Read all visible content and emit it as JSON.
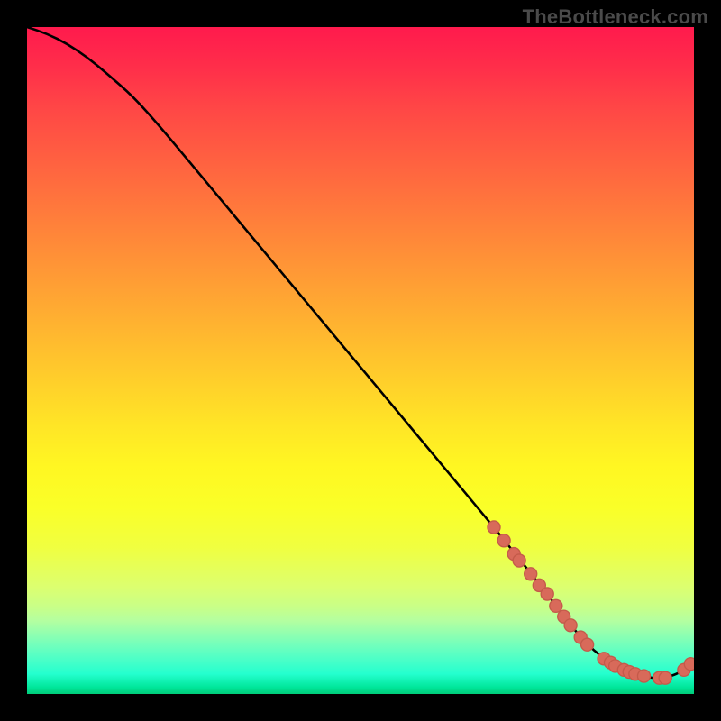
{
  "attribution": "TheBottleneck.com",
  "colors": {
    "curve": "#000000",
    "marker_fill": "#d86a5a",
    "marker_stroke": "#c45a4a"
  },
  "chart_data": {
    "type": "line",
    "title": "",
    "xlabel": "",
    "ylabel": "",
    "xlim": [
      0,
      100
    ],
    "ylim": [
      0,
      100
    ],
    "grid": false,
    "legend": false,
    "series": [
      {
        "name": "curve",
        "x": [
          0,
          3,
          6,
          9,
          12,
          16,
          20,
          25,
          30,
          35,
          40,
          45,
          50,
          55,
          60,
          65,
          70,
          74,
          78,
          81,
          83,
          85,
          87,
          89,
          91,
          93,
          95,
          97,
          98.5,
          100
        ],
        "y": [
          100,
          99,
          97.5,
          95.5,
          93,
          89.5,
          85,
          79,
          73,
          67,
          61,
          55,
          49,
          43,
          37,
          31,
          25,
          20,
          15,
          11,
          8.5,
          6.5,
          5,
          3.8,
          3,
          2.5,
          2.3,
          2.8,
          3.6,
          5
        ]
      }
    ],
    "markers": [
      {
        "x": 70,
        "y": 25
      },
      {
        "x": 71.5,
        "y": 23
      },
      {
        "x": 73,
        "y": 21
      },
      {
        "x": 73.8,
        "y": 20
      },
      {
        "x": 75.5,
        "y": 18
      },
      {
        "x": 76.8,
        "y": 16.3
      },
      {
        "x": 78,
        "y": 15
      },
      {
        "x": 79.3,
        "y": 13.2
      },
      {
        "x": 80.5,
        "y": 11.6
      },
      {
        "x": 81.5,
        "y": 10.3
      },
      {
        "x": 83,
        "y": 8.5
      },
      {
        "x": 84,
        "y": 7.4
      },
      {
        "x": 86.5,
        "y": 5.3
      },
      {
        "x": 87.5,
        "y": 4.7
      },
      {
        "x": 88.2,
        "y": 4.2
      },
      {
        "x": 89.5,
        "y": 3.6
      },
      {
        "x": 90.3,
        "y": 3.3
      },
      {
        "x": 91.2,
        "y": 3.0
      },
      {
        "x": 92.5,
        "y": 2.7
      },
      {
        "x": 94.8,
        "y": 2.4
      },
      {
        "x": 95.7,
        "y": 2.4
      },
      {
        "x": 98.5,
        "y": 3.6
      },
      {
        "x": 99.5,
        "y": 4.5
      }
    ]
  }
}
